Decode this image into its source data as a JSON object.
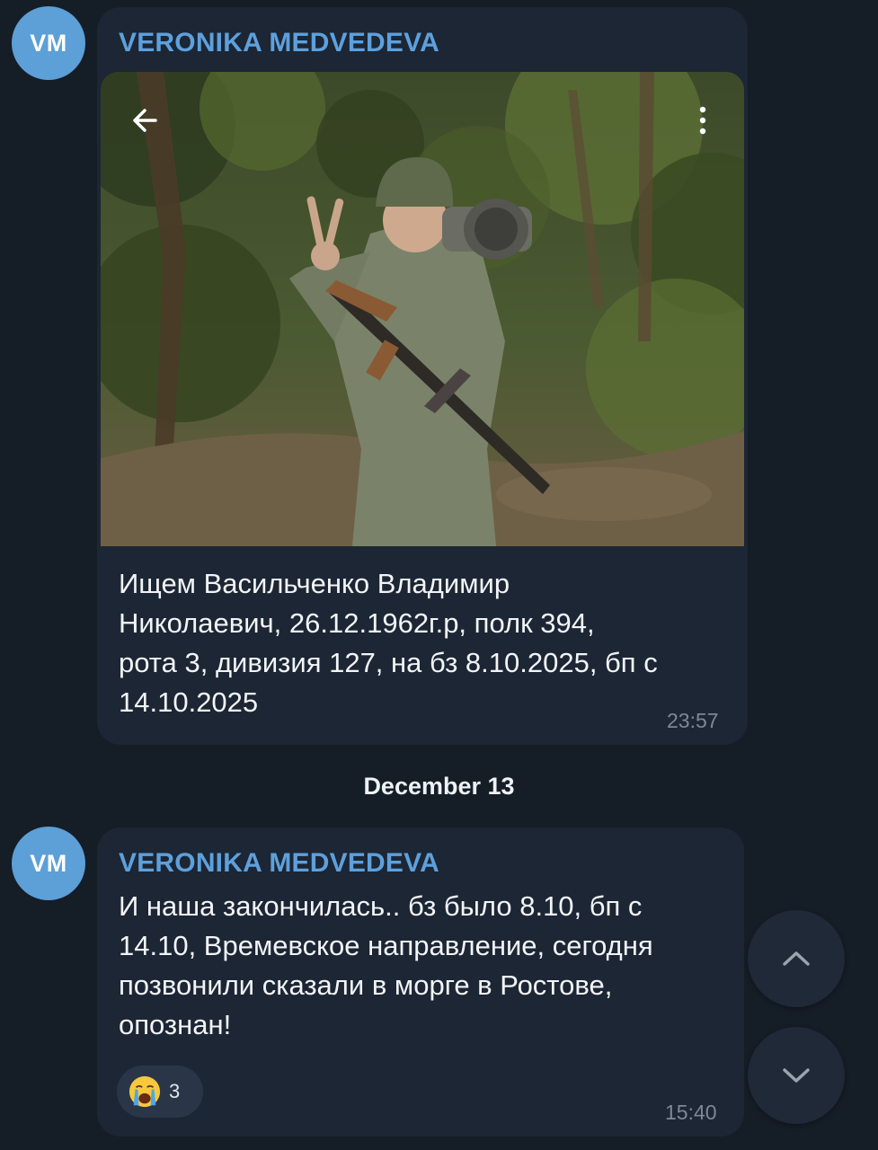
{
  "messages": [
    {
      "avatar_initials": "VM",
      "sender": "VERONIKA MEDVEDEVA",
      "text": "Ищем Васильченко Владимир\nНиколаевич,  26.12.1962г.р, полк 394,\nрота 3, дивизия 127, на бз 8.10.2025, бп с\n14.10.2025",
      "time": "23:57",
      "photo_icons": [
        "back-arrow-icon",
        "more-vert-icon"
      ]
    },
    {
      "avatar_initials": "VM",
      "sender": "VERONIKA MEDVEDEVA",
      "text": "И наша закончилась.. бз было 8.10, бп с\n14.10, Времевское направление,  сегодня\nпозвонили сказали в морге в  Ростове,\nопознан!",
      "time": "15:40",
      "reaction": {
        "emoji": "crying-face-icon",
        "count": "3"
      }
    }
  ],
  "date_separator": "December 13",
  "nav_buttons": [
    "scroll-up-icon",
    "scroll-down-icon"
  ],
  "colors": {
    "background": "#151d27",
    "bubble": "#1c2634",
    "sender_name": "#5da0dc",
    "avatar": "#5d9fd7",
    "timestamp": "#7d8896"
  }
}
